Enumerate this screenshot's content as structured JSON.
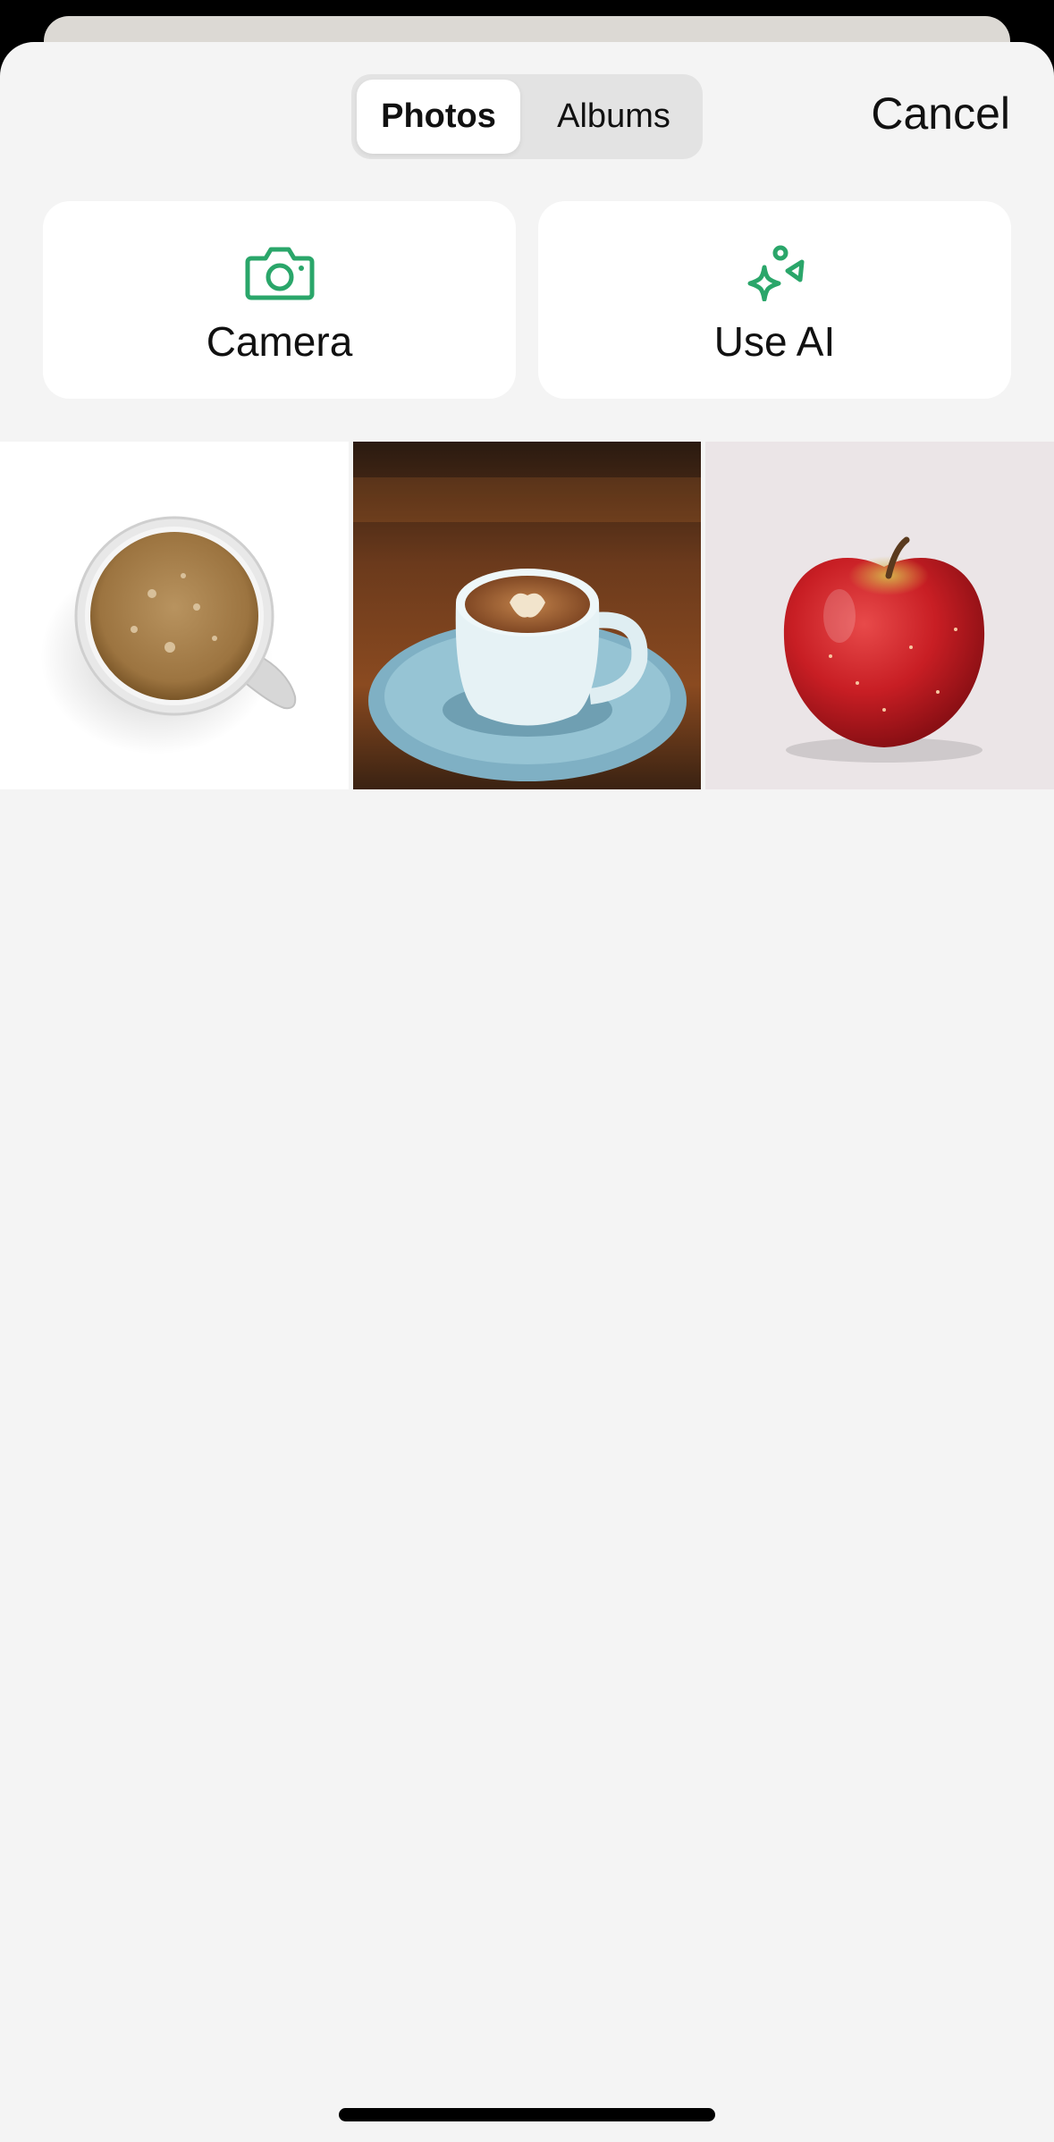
{
  "segmented": {
    "tabs": [
      {
        "label": "Photos",
        "selected": true
      },
      {
        "label": "Albums",
        "selected": false
      }
    ]
  },
  "header": {
    "cancel_label": "Cancel"
  },
  "actions": [
    {
      "label": "Camera",
      "icon": "camera-icon"
    },
    {
      "label": "Use AI",
      "icon": "sparkle-shapes-icon"
    }
  ],
  "colors": {
    "accent": "#2aa66a",
    "sheet_background": "#f4f4f4",
    "card_background": "#ffffff"
  },
  "photos": [
    {
      "subject": "coffee-cup-top-view"
    },
    {
      "subject": "latte-cup-on-saucer"
    },
    {
      "subject": "red-apple"
    }
  ]
}
